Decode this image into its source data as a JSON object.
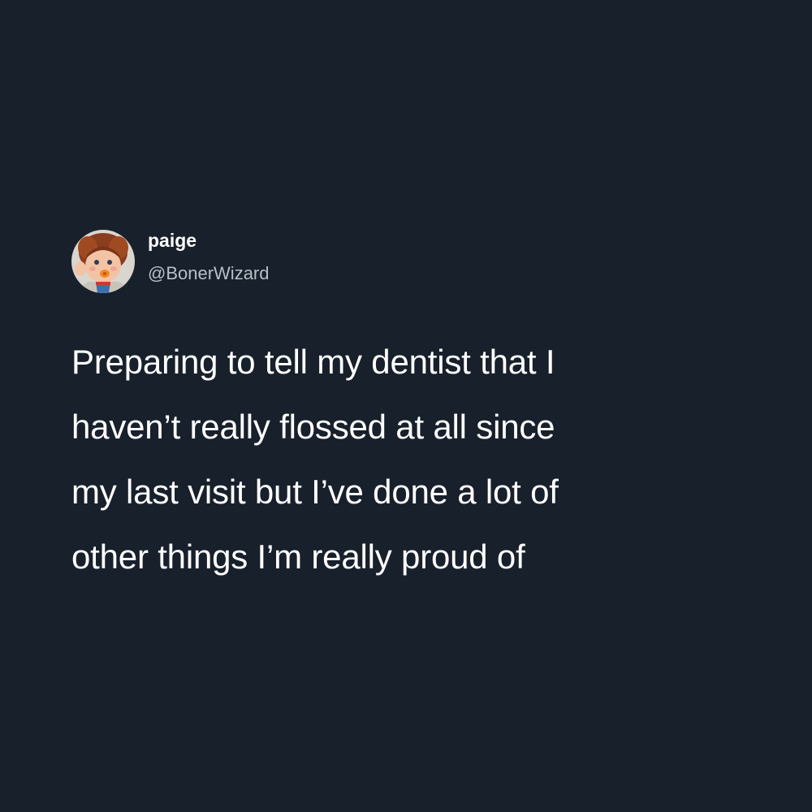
{
  "tweet": {
    "author": {
      "display_name": "paige",
      "handle": "@BonerWizard",
      "avatar_icon": "doll-avatar-icon"
    },
    "text_lines": [
      "Preparing to tell my dentist that I",
      "haven’t really flossed at all since",
      "my last visit but I’ve done a lot of",
      "other things I’m really proud of"
    ]
  },
  "colors": {
    "background": "#18202b",
    "primary_text": "#ffffff",
    "secondary_text": "#b7bfc8"
  }
}
